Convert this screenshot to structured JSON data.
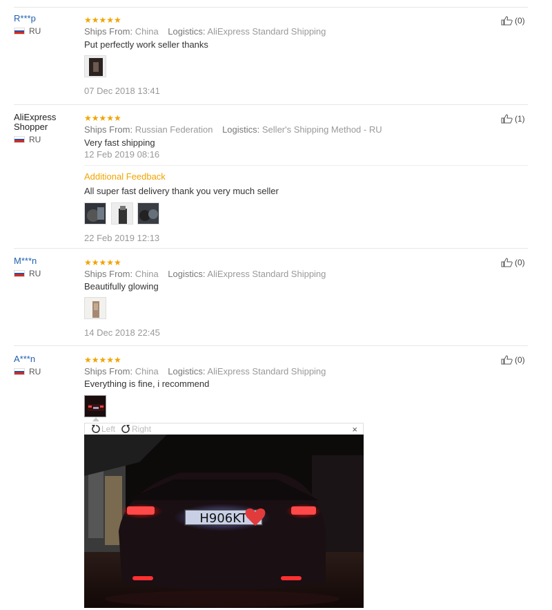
{
  "reviews": [
    {
      "user": "R***p",
      "country": "RU",
      "stars": "★★★★★",
      "ships_label": "Ships From:",
      "ships_value": "China",
      "logistics_label": "Logistics:",
      "logistics_value": "AliExpress Standard Shipping",
      "text": "Put perfectly work seller thanks",
      "date": "07 Dec 2018 13:41",
      "likes": "(0)"
    },
    {
      "user_line1": "AliExpress",
      "user_line2": "Shopper",
      "country": "RU",
      "stars": "★★★★★",
      "ships_label": "Ships From:",
      "ships_value": "Russian Federation",
      "logistics_label": "Logistics:",
      "logistics_value": "Seller's Shipping Method - RU",
      "text": "Very fast shipping",
      "date": "12 Feb 2019 08:16",
      "additional_label": "Additional Feedback",
      "additional_text": "All super fast delivery thank you very much seller",
      "additional_date": "22 Feb 2019 12:13",
      "likes": "(1)"
    },
    {
      "user": "M***n",
      "country": "RU",
      "stars": "★★★★★",
      "ships_label": "Ships From:",
      "ships_value": "China",
      "logistics_label": "Logistics:",
      "logistics_value": "AliExpress Standard Shipping",
      "text": "Beautifully glowing",
      "date": "14 Dec 2018 22:45",
      "likes": "(0)"
    },
    {
      "user": "A***n",
      "country": "RU",
      "stars": "★★★★★",
      "ships_label": "Ships From:",
      "ships_value": "China",
      "logistics_label": "Logistics:",
      "logistics_value": "AliExpress Standard Shipping",
      "text": "Everything is fine, i recommend",
      "likes": "(0)"
    }
  ],
  "viewer": {
    "rotate_left": "Left",
    "rotate_right": "Right",
    "close": "×",
    "plate": "H906KT"
  },
  "colors": {
    "username": "#1f5fae",
    "stars": "#f0a400",
    "meta": "#999999"
  },
  "icons": [
    "thumbs-up-icon",
    "russia-flag-icon",
    "rotate-left-icon",
    "rotate-right-icon",
    "close-icon"
  ]
}
